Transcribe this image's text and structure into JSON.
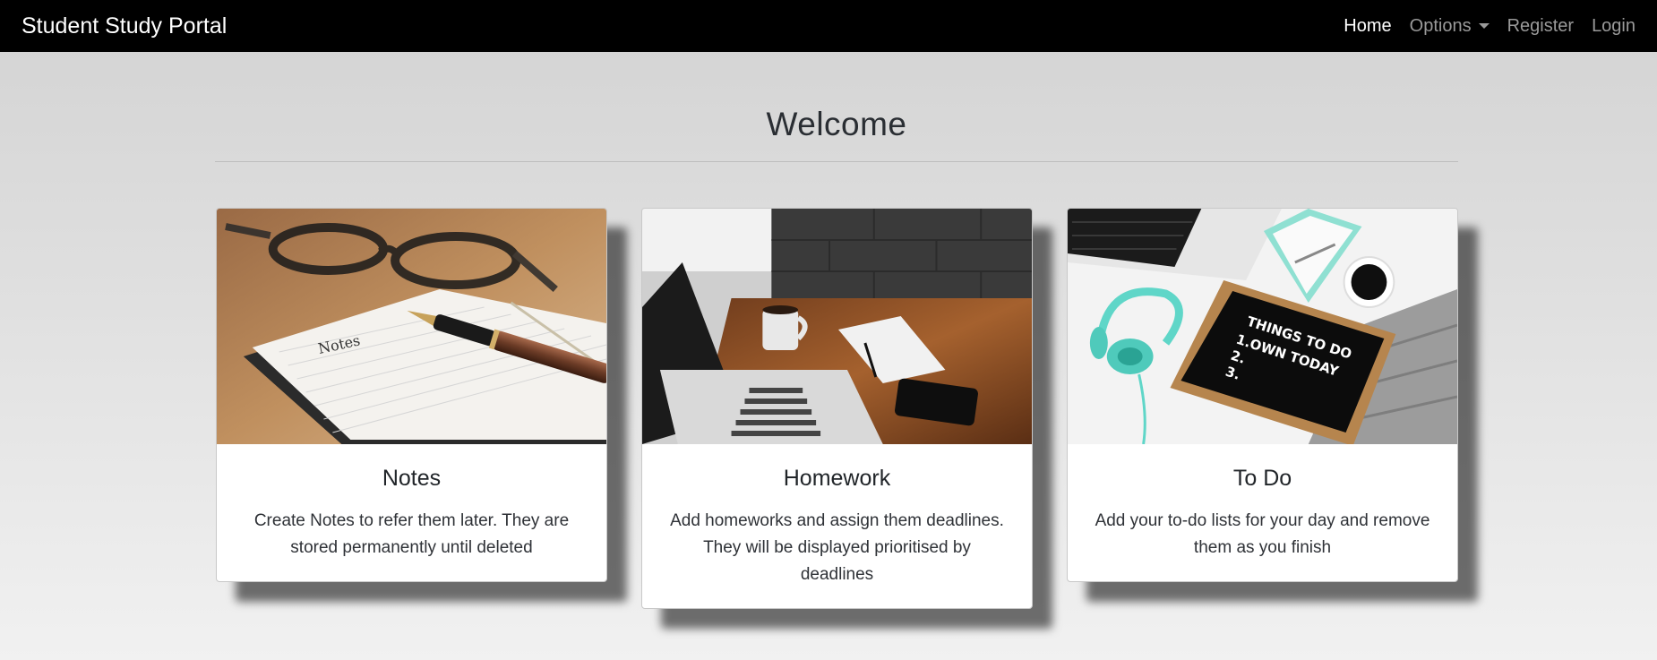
{
  "navbar": {
    "brand": "Student Study Portal",
    "links": [
      {
        "label": "Home",
        "active": true
      },
      {
        "label": "Options",
        "dropdown": true
      },
      {
        "label": "Register"
      },
      {
        "label": "Login"
      }
    ]
  },
  "main": {
    "heading": "Welcome",
    "cards": [
      {
        "title": "Notes",
        "text": "Create Notes to refer them later. They are stored permanently until deleted",
        "image": "notebook-pen-glasses-photo",
        "image_text": "Notes"
      },
      {
        "title": "Homework",
        "text": "Add homeworks and assign them deadlines. They will be displayed prioritised by deadlines",
        "image": "laptop-desk-coffee-photo"
      },
      {
        "title": "To Do",
        "text": "Add your to-do lists for your day and remove them as you finish",
        "image": "letterboard-headphones-photo",
        "image_text": [
          "THINGS TO DO",
          "1.OWN TODAY",
          "2.",
          "3."
        ]
      }
    ]
  }
}
